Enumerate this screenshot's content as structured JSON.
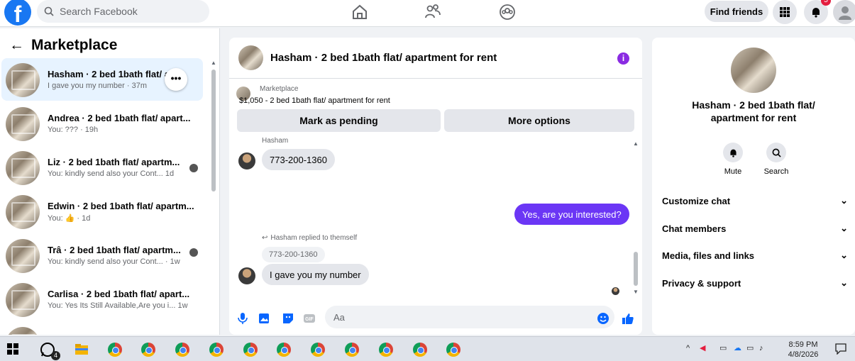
{
  "header": {
    "search_placeholder": "Search Facebook",
    "find_friends": "Find friends",
    "notif_count": "5"
  },
  "sidebar": {
    "title": "Marketplace",
    "conversations": [
      {
        "name": "Hasham · 2 bed 1bath flat/ a",
        "sub": "I gave you my number · 37m"
      },
      {
        "name": "Andrea · 2 bed 1bath flat/ apart...",
        "sub": "You: ??? · 19h"
      },
      {
        "name": "Liz · 2 bed 1bath flat/ apartm...",
        "sub": "You: kindly send also your Cont...   1d"
      },
      {
        "name": "Edwin · 2 bed 1bath flat/ apartm...",
        "sub": "You: 👍 · 1d"
      },
      {
        "name": "Trâ · 2 bed 1bath flat/ apartm...",
        "sub": "You: kindly send also your Cont... · 1w"
      },
      {
        "name": "Carlisa · 2 bed 1bath flat/ apart...",
        "sub": "You: Yes Its Still Available,Are you i...   1w"
      }
    ]
  },
  "chat": {
    "title": "Hasham · 2 bed 1bath flat/ apartment for rent",
    "marketplace_label": "Marketplace",
    "listing": "$1,050 - 2 bed 1bath flat/ apartment for rent",
    "mark_pending": "Mark as pending",
    "more_options": "More options",
    "sender": "Hasham",
    "msg1": "773-200-1360",
    "my_msg": "Yes, are you interested?",
    "replied_note": "Hasham replied to themself",
    "quoted": "773-200-1360",
    "msg2": "I gave you my number",
    "composer_placeholder": "Aa"
  },
  "details": {
    "title": "Hasham · 2 bed 1bath flat/ apartment for rent",
    "mute": "Mute",
    "search": "Search",
    "sections": [
      "Customize chat",
      "Chat members",
      "Media, files and links",
      "Privacy & support"
    ]
  },
  "taskbar": {
    "whatsapp_badge": "4",
    "time": "8:59 PM",
    "date": "4/8/2026"
  },
  "colors": {
    "brand": "#1877f2",
    "my_bubble": "#6b36f5",
    "info_icon": "#8a2be2"
  }
}
